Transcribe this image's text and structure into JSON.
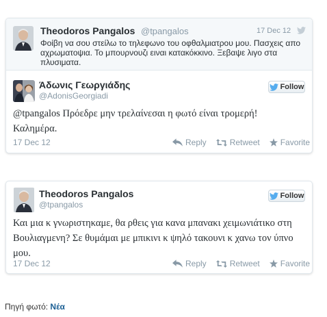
{
  "quoted_tweet": {
    "author_name": "Theodoros Pangalos",
    "handle": "@tpangalos",
    "date": "17 Dec 12",
    "text": "Φοίβη να σου στείλω το τηλεφωνο του οφθαλμιατρου μου. Πασχεις απο αχρωματοψια. Το μπουρνουζι ειναι κατακόκκινο. Ξεβαψε λιγο στα πλυσιματα."
  },
  "reply_tweet": {
    "author_name": "Άδωνις Γεωργιάδης",
    "handle": "@AdonisGeorgiadi",
    "follow_label": "Follow",
    "text": "@tpangalos Πρόεδρε μην τρελαίνεσαι η φωτό είναι τρομερή! Καλημέρα.",
    "date": "17 Dec 12",
    "actions": {
      "reply": "Reply",
      "retweet": "Retweet",
      "favorite": "Favorite"
    }
  },
  "second_tweet": {
    "author_name": "Theodoros Pangalos",
    "handle": "@tpangalos",
    "follow_label": "Follow",
    "text": "Και μια κ γνωριστηκαμε, θα ρθεις για κανα μπανακι χειμωνιάτικο στη Βουλιαγμενη? Σε θυμάμαι με μπικινι κ ψηλό τακουνι κ χανω τον ύπνο μου.",
    "date": "17 Dec 12",
    "actions": {
      "reply": "Reply",
      "retweet": "Retweet",
      "favorite": "Favorite"
    }
  },
  "footer": {
    "source_label": "Πηγή φωτό:",
    "source_link": "Νέα"
  },
  "colors": {
    "twitter_blue": "#55acee",
    "link": "#1a5e93",
    "muted": "#8899a6"
  }
}
